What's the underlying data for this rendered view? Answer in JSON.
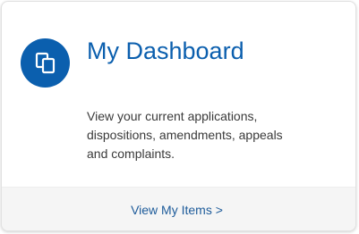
{
  "card": {
    "icon": "copy-documents-icon",
    "title": "My Dashboard",
    "description": "View your current applications, dispositions, amendments, appeals and complaints.",
    "link_label": "View My Items >"
  },
  "colors": {
    "accent": "#0b5fae",
    "link": "#1d5b9a",
    "footer_bg": "#f5f5f5",
    "text": "#3a3a3a"
  }
}
